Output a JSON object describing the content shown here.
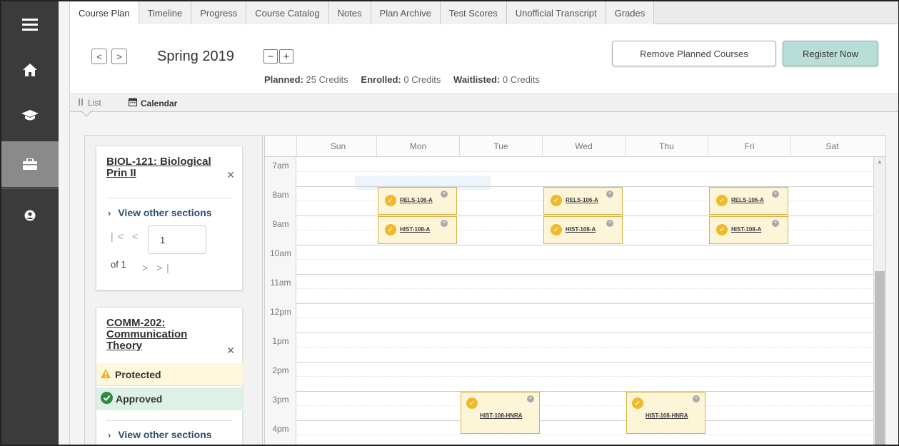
{
  "rail": {
    "items": [
      {
        "icon": "menu-icon"
      },
      {
        "icon": "home-icon"
      },
      {
        "icon": "graduation-cap-icon"
      },
      {
        "icon": "briefcase-icon"
      },
      {
        "icon": "user-circle-icon"
      }
    ]
  },
  "tabs": [
    {
      "label": "Course Plan"
    },
    {
      "label": "Timeline"
    },
    {
      "label": "Progress"
    },
    {
      "label": "Course Catalog"
    },
    {
      "label": "Notes"
    },
    {
      "label": "Plan Archive"
    },
    {
      "label": "Test Scores"
    },
    {
      "label": "Unofficial Transcript"
    },
    {
      "label": "Grades"
    }
  ],
  "term": {
    "prev": "<",
    "next": ">",
    "title": "Spring 2019",
    "collapse": "−",
    "expand": "+",
    "planned_label": "Planned:",
    "planned_value": "25 Credits",
    "enrolled_label": "Enrolled:",
    "enrolled_value": "0 Credits",
    "waitlisted_label": "Waitlisted:",
    "waitlisted_value": "0 Credits",
    "remove_button": "Remove Planned Courses",
    "register_button": "Register Now"
  },
  "view": {
    "list_label": "List",
    "calendar_label": "Calendar"
  },
  "cards": [
    {
      "title": "BIOL-121: Biological Prin II",
      "view_sections": "View other sections",
      "page_value": "1",
      "of_label": "of 1"
    },
    {
      "title": "COMM-202: Communication Theory",
      "protected": "Protected",
      "approved": "Approved",
      "view_sections": "View other sections"
    }
  ],
  "calendar": {
    "days": [
      "Sun",
      "Mon",
      "Tue",
      "Wed",
      "Thu",
      "Fri",
      "Sat"
    ],
    "times": [
      "7am",
      "8am",
      "9am",
      "10am",
      "11am",
      "12pm",
      "1pm",
      "2pm",
      "3pm",
      "4pm"
    ],
    "events": [
      {
        "code": "RELS-106-A",
        "day": "Mon",
        "start": "8am"
      },
      {
        "code": "RELS-106-A",
        "day": "Wed",
        "start": "8am"
      },
      {
        "code": "RELS-106-A",
        "day": "Fri",
        "start": "8am"
      },
      {
        "code": "HIST-108-A",
        "day": "Mon",
        "start": "9am"
      },
      {
        "code": "HIST-108-A",
        "day": "Wed",
        "start": "9am"
      },
      {
        "code": "HIST-108-A",
        "day": "Fri",
        "start": "9am"
      },
      {
        "code": "HIST-108-HNRA",
        "day": "Tue",
        "start": "3pm"
      },
      {
        "code": "HIST-108-HNRA",
        "day": "Thu",
        "start": "3pm"
      }
    ]
  },
  "colors": {
    "rail": "#3b3b3b",
    "register": "#b9ddd7",
    "event_fill": "#fdf5d8",
    "event_border": "#d9b242",
    "check": "#f0b929",
    "protected_bg": "#fdf7dc",
    "approved_bg": "#ddf1e7"
  }
}
